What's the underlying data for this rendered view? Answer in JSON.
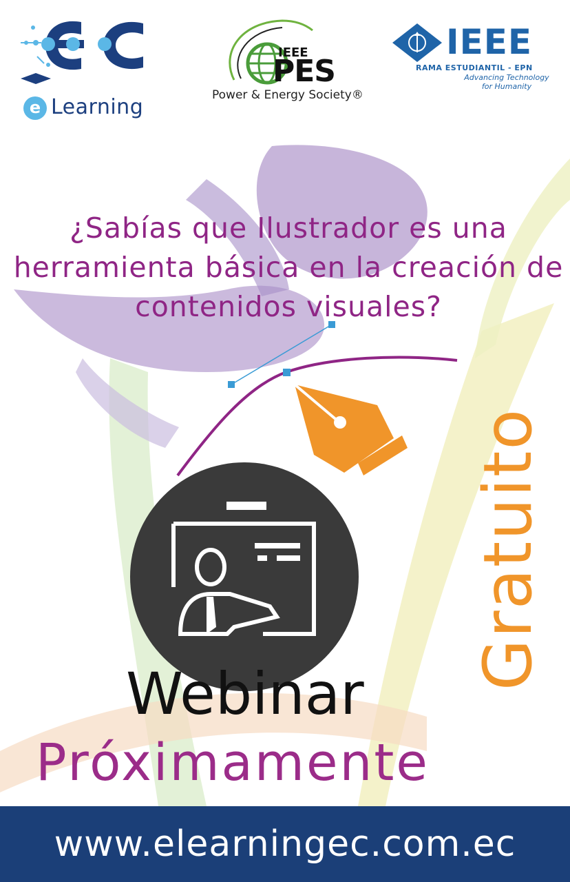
{
  "logos": {
    "ec": {
      "mark": "EC",
      "e_badge": "e",
      "word": "Learning",
      "colors": {
        "navy": "#1c3f7f",
        "light_blue": "#5bb7e6"
      }
    },
    "pes": {
      "ieee": "IEEE",
      "name": "PES",
      "tagline": "Power & Energy Society®"
    },
    "ieee": {
      "name": "IEEE",
      "branch": "RAMA ESTUDIANTIL - EPN",
      "slogan": "Advancing Technology for Humanity",
      "color": "#1f64a8"
    }
  },
  "headline": "¿Sabías que Ilustrador es una herramienta básica en la creación de contenidos visuales?",
  "side_label": "Gratuito",
  "event_type": "Webinar",
  "status": "Próximamente",
  "footer": {
    "url": "www.elearningec.com.ec"
  },
  "icons": [
    "pen-tool-icon",
    "bezier-curve-icon",
    "presentation-teacher-icon"
  ],
  "colors": {
    "purple": "#8f2585",
    "orange": "#f0952a",
    "navy_band": "#1b3f78",
    "dark_circle": "#3a3a3a",
    "lavender": "#b9a3d1",
    "light_yellow": "#f3f1c4",
    "pale_green": "#d9ecc9",
    "pale_peach": "#f7dcc3"
  }
}
